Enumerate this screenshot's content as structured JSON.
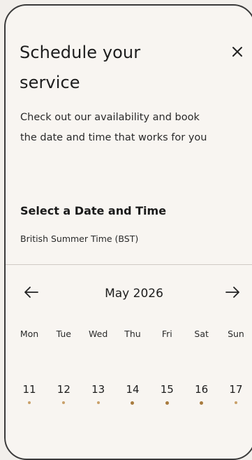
{
  "dialog": {
    "title": "Schedule your service",
    "description": "Check out our availability and book the date and time that works for you",
    "close_icon": "close-icon"
  },
  "picker": {
    "section_title": "Select a Date and Time",
    "timezone": "British Summer Time (BST)",
    "month_label": "May 2026",
    "prev_icon": "arrow-left-icon",
    "next_icon": "arrow-right-icon",
    "weekdays": [
      "Mon",
      "Tue",
      "Wed",
      "Thu",
      "Fri",
      "Sat",
      "Sun"
    ],
    "dates": [
      "11",
      "12",
      "13",
      "14",
      "15",
      "16",
      "17"
    ]
  },
  "colors": {
    "availability_dot": "#c9a06a",
    "availability_dot_strong": "#a87b3e",
    "border": "#3a3a3a"
  }
}
